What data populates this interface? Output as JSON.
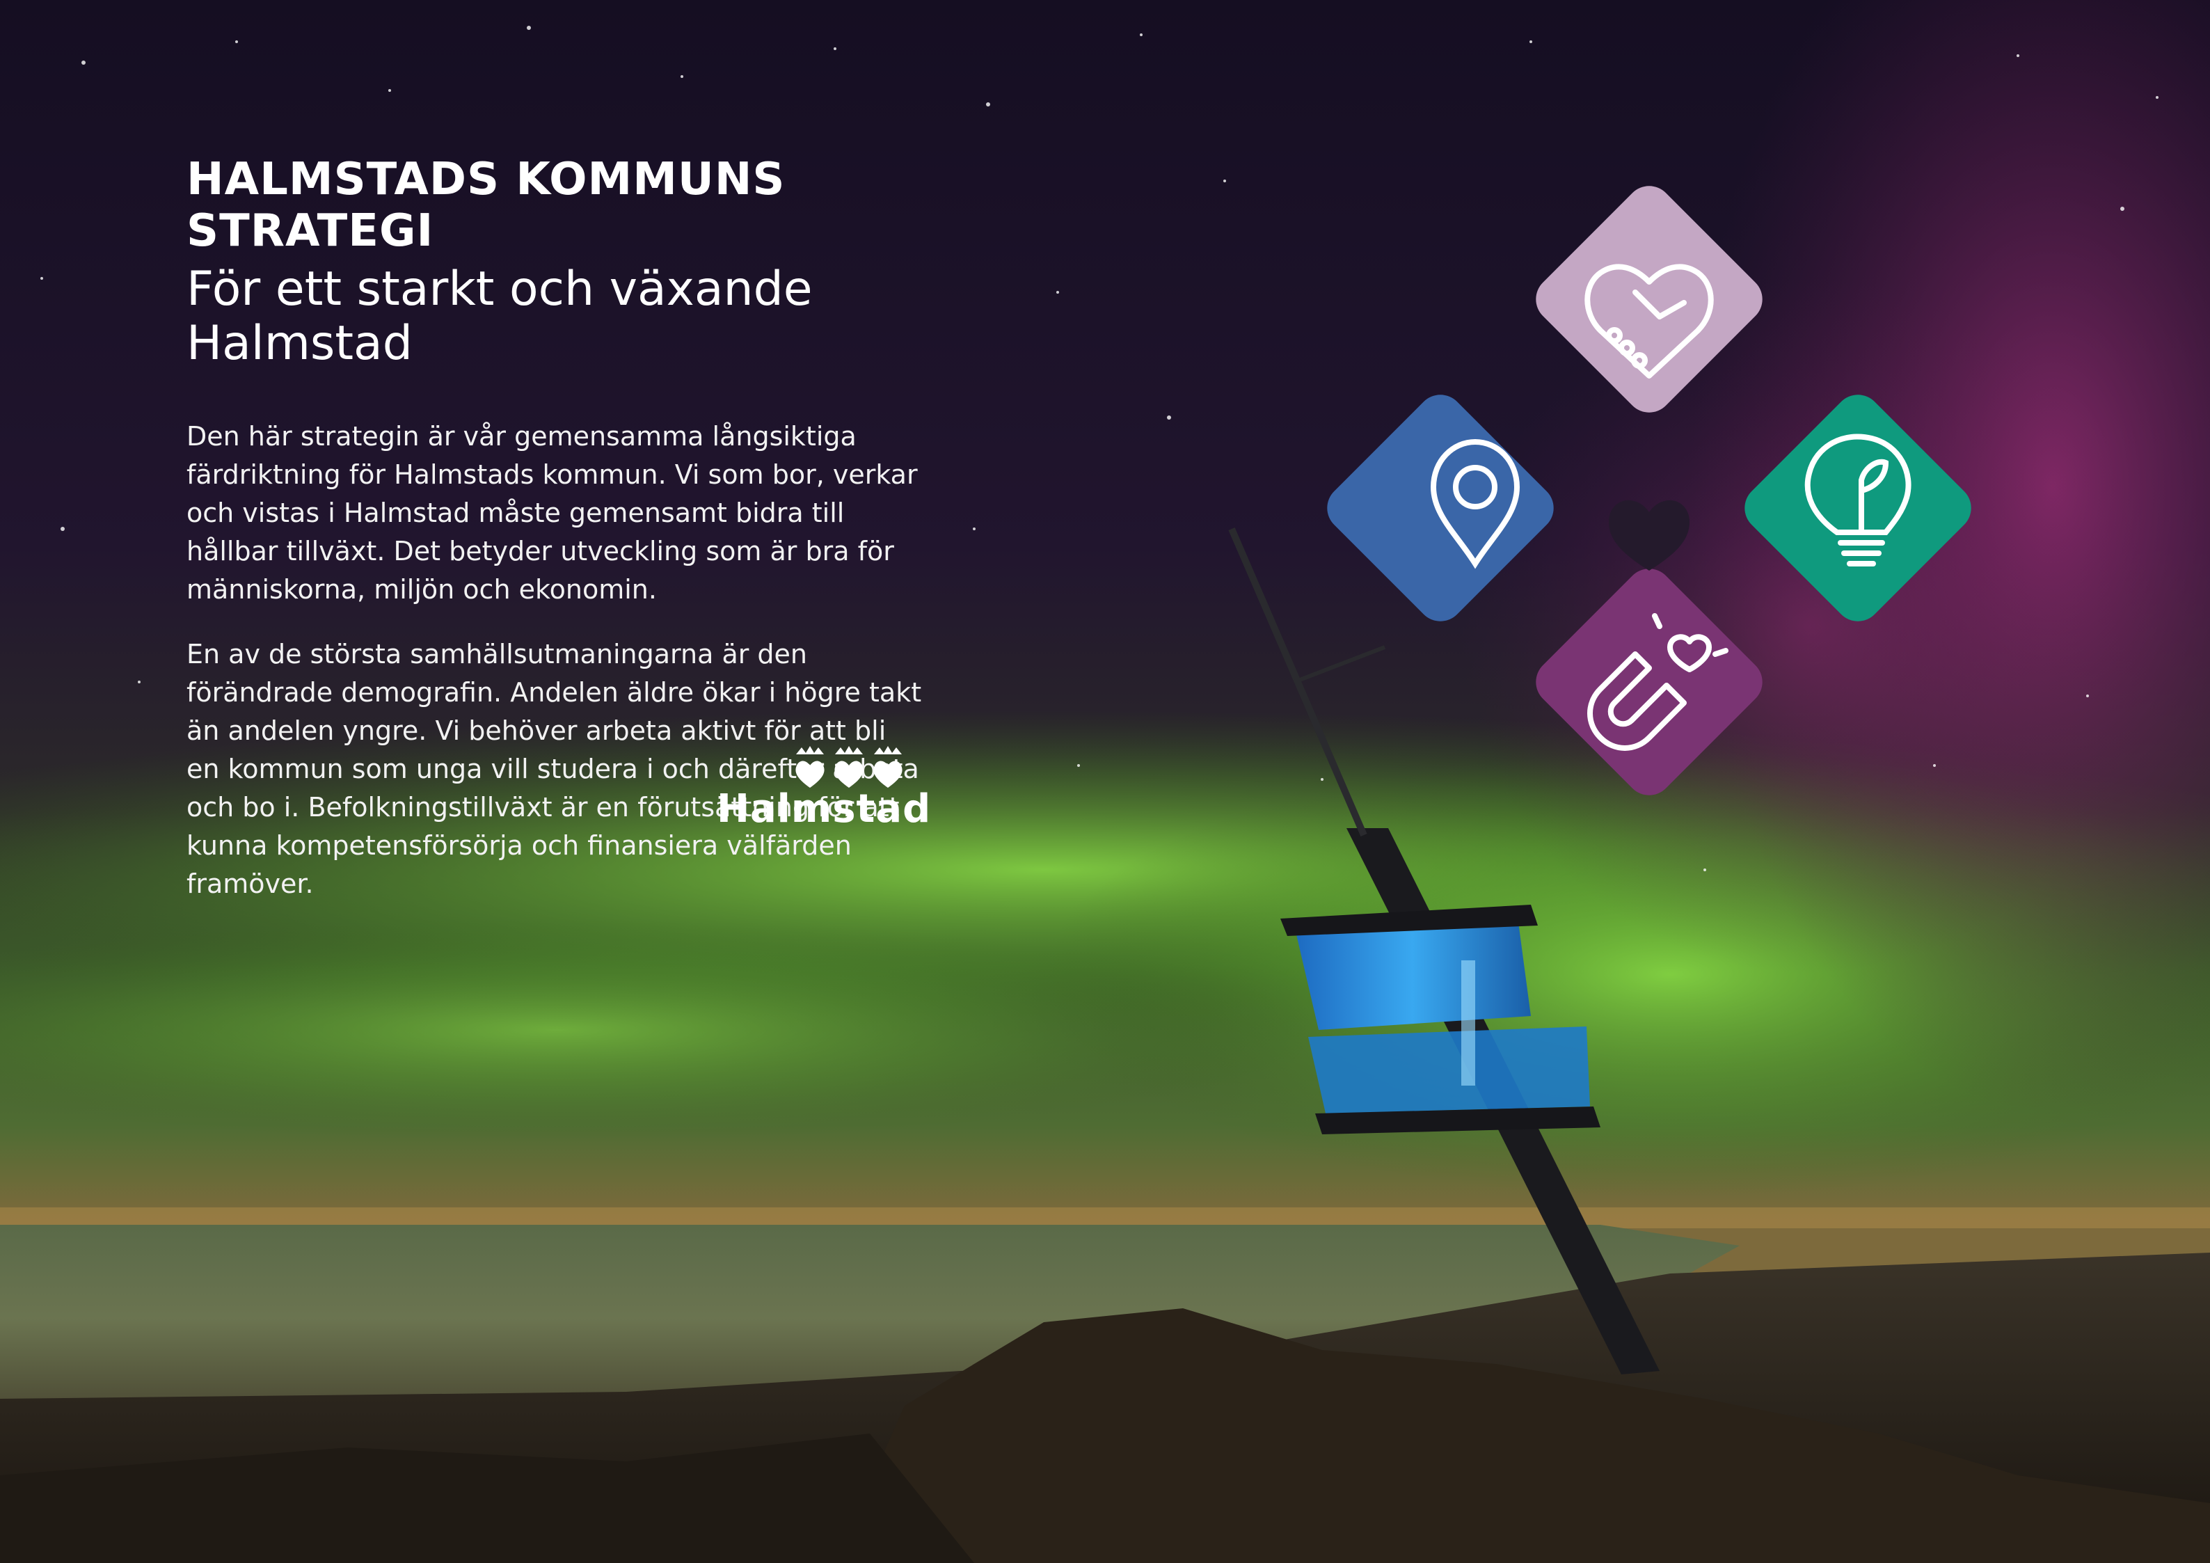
{
  "header": {
    "title": "HALMSTADS KOMMUNS STRATEGI",
    "subtitle": "För ett starkt och växande Halmstad"
  },
  "body": {
    "paragraphs": [
      "Den här strategin är vår gemensamma långsiktiga färdriktning för Halmstads kommun. Vi som bor, verkar och vistas i Halmstad måste gemensamt bidra till hållbar tillväxt. Det betyder utveckling som är bra för människorna, miljön och ekonomin.",
      "En av de största samhällsutmaningarna är den förändrade demografin. Andelen äldre ökar i högre takt än andelen yngre. Vi behöver arbeta aktivt för att bli en kommun som unga vill studera i och därefter arbeta och bo i. Befolkningstillväxt är en förutsättning för att kunna kompetensförsörja och finansiera välfärden framöver."
    ]
  },
  "logo": {
    "word": "Halmstad",
    "icon": "three-crowned-hearts-icon"
  },
  "diamonds": [
    {
      "icon": "handshake-heart-icon",
      "color": "#c4a7c4"
    },
    {
      "icon": "location-pin-icon",
      "color": "#3a66a8"
    },
    {
      "icon": "lightbulb-leaf-icon",
      "color": "#0f9a7e"
    },
    {
      "icon": "magnet-heart-icon",
      "color": "#7a3473"
    }
  ],
  "colors": {
    "sky_top": "#160f24",
    "aurora_green": "#7ccf3a",
    "aurora_purple": "#8a2a6a",
    "tower_light": "#2f8fe0"
  }
}
